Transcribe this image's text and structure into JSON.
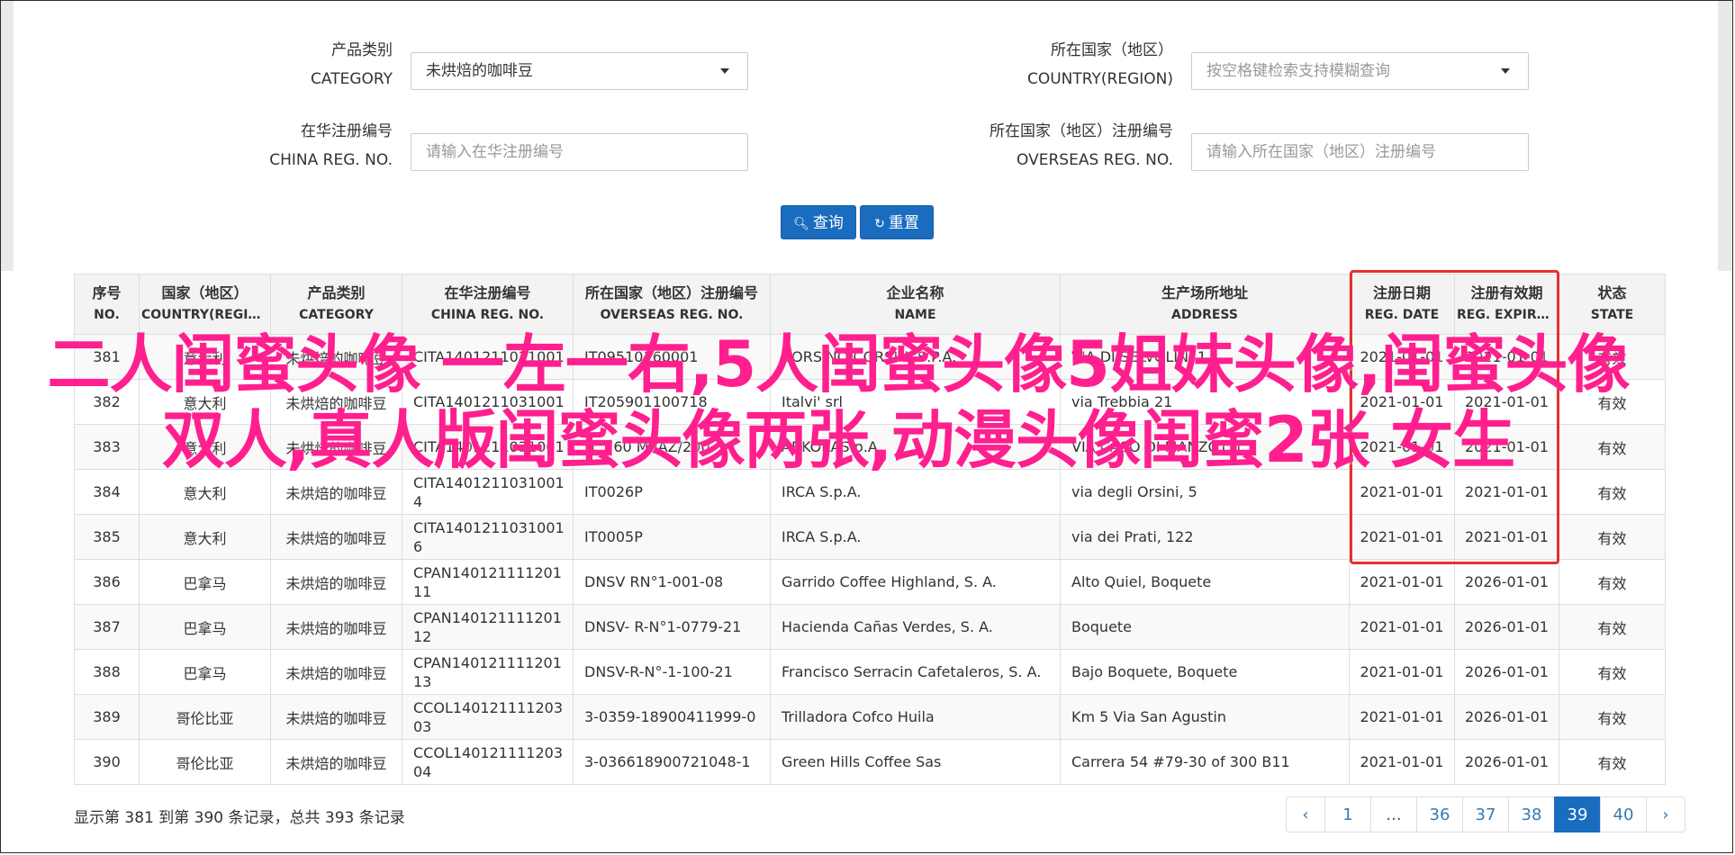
{
  "form": {
    "category_label_cn": "产品类别",
    "category_label_en": "CATEGORY",
    "category_value": "未烘焙的咖啡豆",
    "country_label_cn": "所在国家（地区）",
    "country_label_en": "COUNTRY(REGION)",
    "country_placeholder": "按空格键检索支持模糊查询",
    "china_reg_label_cn": "在华注册编号",
    "china_reg_label_en": "CHINA REG. NO.",
    "china_reg_placeholder": "请输入在华注册编号",
    "overseas_reg_label_cn": "所在国家（地区）注册编号",
    "overseas_reg_label_en": "OVERSEAS REG. NO.",
    "overseas_reg_placeholder": "请输入所在国家（地区）注册编号",
    "query_button": "查询",
    "reset_button": "重置"
  },
  "table": {
    "headers": [
      {
        "cn": "序号",
        "en": "NO."
      },
      {
        "cn": "国家（地区）",
        "en": "COUNTRY(REGIO..."
      },
      {
        "cn": "产品类别",
        "en": "CATEGORY"
      },
      {
        "cn": "在华注册编号",
        "en": "CHINA REG. NO."
      },
      {
        "cn": "所在国家（地区）注册编号",
        "en": "OVERSEAS REG. NO."
      },
      {
        "cn": "企业名称",
        "en": "NAME"
      },
      {
        "cn": "生产场所地址",
        "en": "ADDRESS"
      },
      {
        "cn": "注册日期",
        "en": "REG. DATE"
      },
      {
        "cn": "注册有效期",
        "en": "REG. EXPIRE ..."
      },
      {
        "cn": "状态",
        "en": "STATE"
      }
    ],
    "rows": [
      {
        "no": "381",
        "country": "意大利",
        "category": "未烘焙的咖啡豆",
        "china_reg": "CITA1401211031001",
        "overseas_reg": "IT09510160001",
        "name": "CORSINO CORSINI S.P.A.",
        "address": "VIA DI SELVOLINI 1",
        "reg_date": "2021-01-01",
        "expire": "2021-01-01",
        "state": "有效"
      },
      {
        "no": "382",
        "country": "意大利",
        "category": "未烘焙的咖啡豆",
        "china_reg": "CITA1401211031001",
        "overseas_reg": "IT205901100718",
        "name": "Italvi' srl",
        "address": "via Trebbia 21",
        "reg_date": "2021-01-01",
        "expire": "2021-01-01",
        "state": "有效"
      },
      {
        "no": "383",
        "country": "意大利",
        "category": "未烘焙的咖啡豆",
        "china_reg": "CITA1401211031001",
        "overseas_reg": "N. 760 MI/AZ/200",
        "name": "ARKOKAS.p.A.",
        "address": "VIA CASO DI MANZOTTI",
        "reg_date": "2021-01-01",
        "expire": "2021-01-01",
        "state": "有效"
      },
      {
        "no": "384",
        "country": "意大利",
        "category": "未烘焙的咖啡豆",
        "china_reg": "CITA14012110310014",
        "overseas_reg": "IT0026P",
        "name": "IRCA S.p.A.",
        "address": "via degli Orsini, 5",
        "reg_date": "2021-01-01",
        "expire": "2021-01-01",
        "state": "有效"
      },
      {
        "no": "385",
        "country": "意大利",
        "category": "未烘焙的咖啡豆",
        "china_reg": "CITA14012110310016",
        "overseas_reg": "IT0005P",
        "name": "IRCA S.p.A.",
        "address": "via dei Prati, 122",
        "reg_date": "2021-01-01",
        "expire": "2021-01-01",
        "state": "有效"
      },
      {
        "no": "386",
        "country": "巴拿马",
        "category": "未烘焙的咖啡豆",
        "china_reg": "CPAN14012111120111",
        "overseas_reg": "DNSV RN°1-001-08",
        "name": "Garrido Coffee Highland, S. A.",
        "address": "Alto Quiel, Boquete",
        "reg_date": "2021-01-01",
        "expire": "2026-01-01",
        "state": "有效"
      },
      {
        "no": "387",
        "country": "巴拿马",
        "category": "未烘焙的咖啡豆",
        "china_reg": "CPAN14012111120112",
        "overseas_reg": "DNSV- R-N°1-0779-21",
        "name": "Hacienda Cañas Verdes, S. A.",
        "address": "Boquete",
        "reg_date": "2021-01-01",
        "expire": "2026-01-01",
        "state": "有效"
      },
      {
        "no": "388",
        "country": "巴拿马",
        "category": "未烘焙的咖啡豆",
        "china_reg": "CPAN14012111120113",
        "overseas_reg": "DNSV-R-N°-1-100-21",
        "name": "Francisco Serracin Cafetaleros, S. A.",
        "address": "Bajo Boquete, Boquete",
        "reg_date": "2021-01-01",
        "expire": "2026-01-01",
        "state": "有效"
      },
      {
        "no": "389",
        "country": "哥伦比亚",
        "category": "未烘焙的咖啡豆",
        "china_reg": "CCOL14012111120303",
        "overseas_reg": "3-0359-18900411999-0",
        "name": "Trilladora Cofco Huila",
        "address": "Km 5 Via San Agustin",
        "reg_date": "2021-01-01",
        "expire": "2026-01-01",
        "state": "有效"
      },
      {
        "no": "390",
        "country": "哥伦比亚",
        "category": "未烘焙的咖啡豆",
        "china_reg": "CCOL14012111120304",
        "overseas_reg": "3-036618900721048-1",
        "name": "Green Hills Coffee Sas",
        "address": "Carrera 54 #79-30 of 300 B11",
        "reg_date": "2021-01-01",
        "expire": "2026-01-01",
        "state": "有效"
      }
    ]
  },
  "summary": "显示第 381 到第 390 条记录，总共 393 条记录",
  "pagination": {
    "prev": "‹",
    "pages": [
      "1",
      "...",
      "36",
      "37",
      "38",
      "39",
      "40"
    ],
    "active": "39",
    "next": "›"
  },
  "overlay_text": "二人闺蜜头像 一左一右,5人闺蜜头像5姐妹头像,闺蜜头像双人,真人版闺蜜头像两张,动漫头像闺蜜2张 女生",
  "colors": {
    "primary": "#1a6cbf",
    "highlight_border": "#e33131",
    "overlay": "#ff1f8e"
  }
}
